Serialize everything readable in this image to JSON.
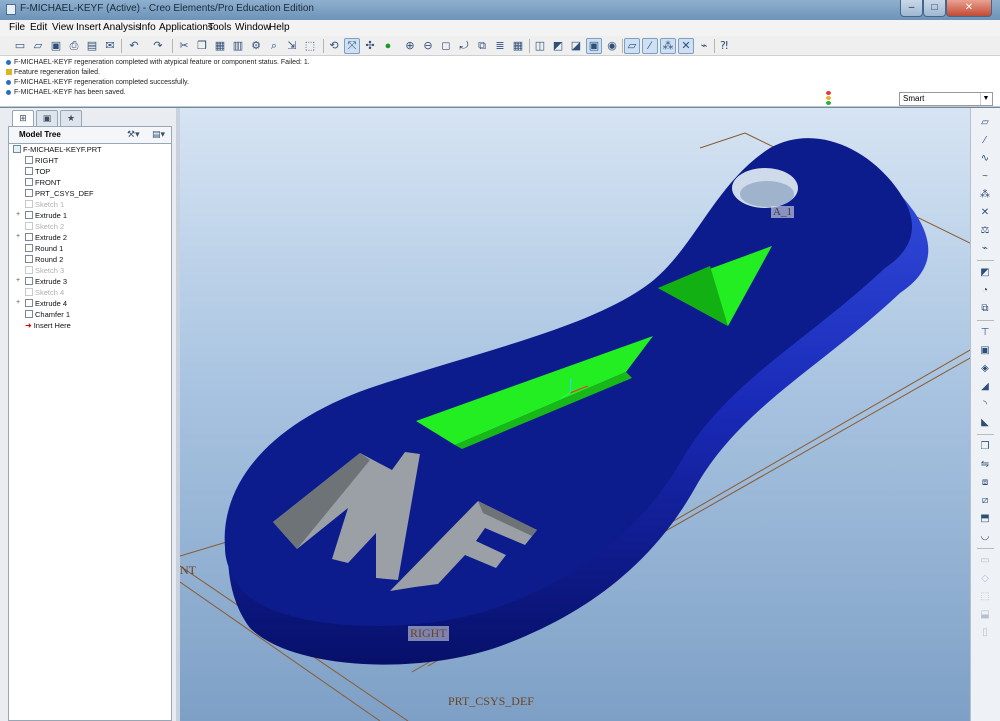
{
  "window": {
    "title": "F-MICHAEL-KEYF (Active) - Creo Elements/Pro Education Edition"
  },
  "menu": [
    "File",
    "Edit",
    "View",
    "Insert",
    "Analysis",
    "Info",
    "Applications",
    "Tools",
    "Window",
    "Help"
  ],
  "messages": [
    {
      "kind": "info",
      "text": "F-MICHAEL-KEYF regeneration completed with atypical feature or component status. Failed: 1."
    },
    {
      "kind": "warning",
      "text": "Feature regeneration failed."
    },
    {
      "kind": "info",
      "text": "F-MICHAEL-KEYF regeneration completed successfully."
    },
    {
      "kind": "info",
      "text": "F-MICHAEL-KEYF has been saved."
    }
  ],
  "filter": {
    "value": "Smart"
  },
  "model_tree": {
    "title": "Model Tree",
    "nodes": [
      {
        "label": "F-MICHAEL-KEYF.PRT",
        "icon": "part-icon",
        "dim": false
      },
      {
        "label": "RIGHT",
        "icon": "datum-plane-icon",
        "dim": false
      },
      {
        "label": "TOP",
        "icon": "datum-plane-icon",
        "dim": false
      },
      {
        "label": "FRONT",
        "icon": "datum-plane-icon",
        "dim": false
      },
      {
        "label": "PRT_CSYS_DEF",
        "icon": "csys-icon",
        "dim": false
      },
      {
        "label": "Sketch 1",
        "icon": "sketch-icon",
        "dim": true
      },
      {
        "label": "Extrude 1",
        "icon": "extrude-icon",
        "dim": false
      },
      {
        "label": "Sketch 2",
        "icon": "sketch-icon",
        "dim": true
      },
      {
        "label": "Extrude 2",
        "icon": "extrude-icon",
        "dim": false
      },
      {
        "label": "Round 1",
        "icon": "round-icon",
        "dim": false
      },
      {
        "label": "Round 2",
        "icon": "round-icon",
        "dim": false
      },
      {
        "label": "Sketch 3",
        "icon": "sketch-icon",
        "dim": true
      },
      {
        "label": "Extrude 3",
        "icon": "extrude-icon",
        "dim": false
      },
      {
        "label": "Sketch 4",
        "icon": "sketch-icon",
        "dim": true
      },
      {
        "label": "Extrude 4",
        "icon": "extrude-icon",
        "dim": false
      },
      {
        "label": "Chamfer 1",
        "icon": "chamfer-icon",
        "dim": false
      },
      {
        "label": "Insert Here",
        "icon": "insert-here-arrow-icon",
        "dim": false
      }
    ]
  },
  "viewport": {
    "datum_labels": {
      "a1": "A_1",
      "front": "NT",
      "right": "RIGHT",
      "csys": "PRT_CSYS_DEF"
    },
    "engraved_text": "MF",
    "colors": {
      "body": "#0d1c8c",
      "highlight": "#22ee22",
      "engrave": "#9aa0a6",
      "datum": "#8a5a30"
    }
  }
}
